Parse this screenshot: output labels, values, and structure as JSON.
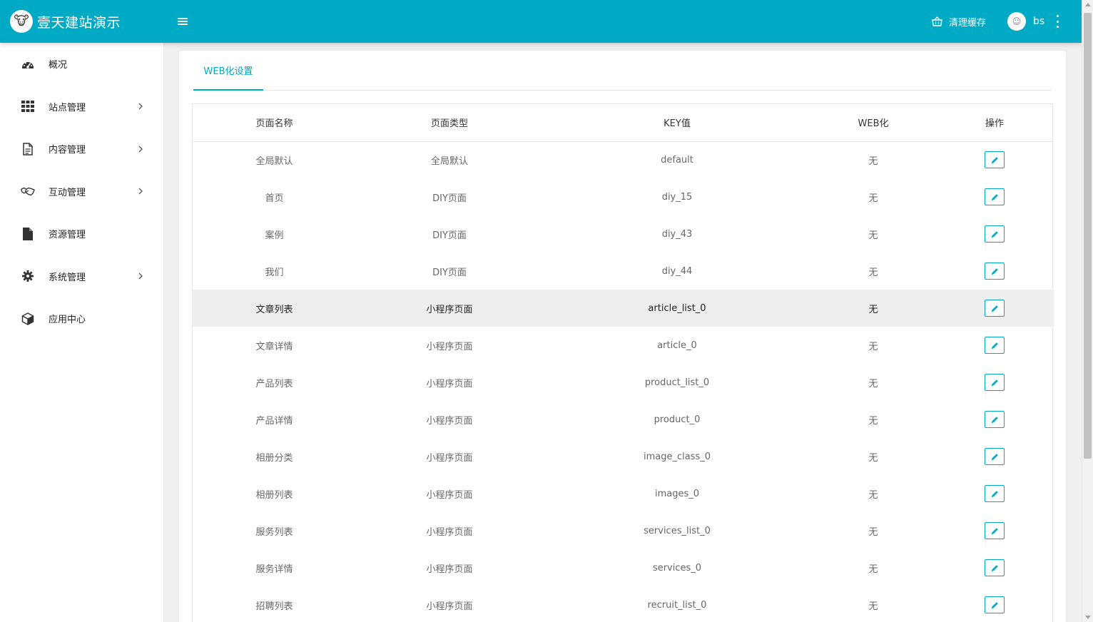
{
  "header": {
    "brand_title": "壹天建站演示",
    "clear_cache_label": "清理缓存",
    "username": "bs",
    "accent_color": "#00aac4"
  },
  "sidebar": {
    "items": [
      {
        "label": "概况",
        "icon": "dashboard-icon",
        "has_children": false
      },
      {
        "label": "站点管理",
        "icon": "grid-icon",
        "has_children": true
      },
      {
        "label": "内容管理",
        "icon": "document-icon",
        "has_children": true
      },
      {
        "label": "互动管理",
        "icon": "handshake-icon",
        "has_children": true
      },
      {
        "label": "资源管理",
        "icon": "file-icon",
        "has_children": false
      },
      {
        "label": "系统管理",
        "icon": "gear-icon",
        "has_children": true
      },
      {
        "label": "应用中心",
        "icon": "cube-icon",
        "has_children": false
      }
    ]
  },
  "main": {
    "tabs": [
      {
        "label": "WEB化设置",
        "active": true
      }
    ],
    "table": {
      "columns": [
        "页面名称",
        "页面类型",
        "KEY值",
        "WEB化",
        "操作"
      ],
      "rows": [
        {
          "name": "全局默认",
          "type": "全局默认",
          "key": "default",
          "web": "无"
        },
        {
          "name": "首页",
          "type": "DIY页面",
          "key": "diy_15",
          "web": "无"
        },
        {
          "name": "案例",
          "type": "DIY页面",
          "key": "diy_43",
          "web": "无"
        },
        {
          "name": "我们",
          "type": "DIY页面",
          "key": "diy_44",
          "web": "无"
        },
        {
          "name": "文章列表",
          "type": "小程序页面",
          "key": "article_list_0",
          "web": "无"
        },
        {
          "name": "文章详情",
          "type": "小程序页面",
          "key": "article_0",
          "web": "无"
        },
        {
          "name": "产品列表",
          "type": "小程序页面",
          "key": "product_list_0",
          "web": "无"
        },
        {
          "name": "产品详情",
          "type": "小程序页面",
          "key": "product_0",
          "web": "无"
        },
        {
          "name": "相册分类",
          "type": "小程序页面",
          "key": "image_class_0",
          "web": "无"
        },
        {
          "name": "相册列表",
          "type": "小程序页面",
          "key": "images_0",
          "web": "无"
        },
        {
          "name": "服务列表",
          "type": "小程序页面",
          "key": "services_list_0",
          "web": "无"
        },
        {
          "name": "服务详情",
          "type": "小程序页面",
          "key": "services_0",
          "web": "无"
        },
        {
          "name": "招聘列表",
          "type": "小程序页面",
          "key": "recruit_list_0",
          "web": "无"
        }
      ],
      "highlighted_row_index": 4
    }
  }
}
